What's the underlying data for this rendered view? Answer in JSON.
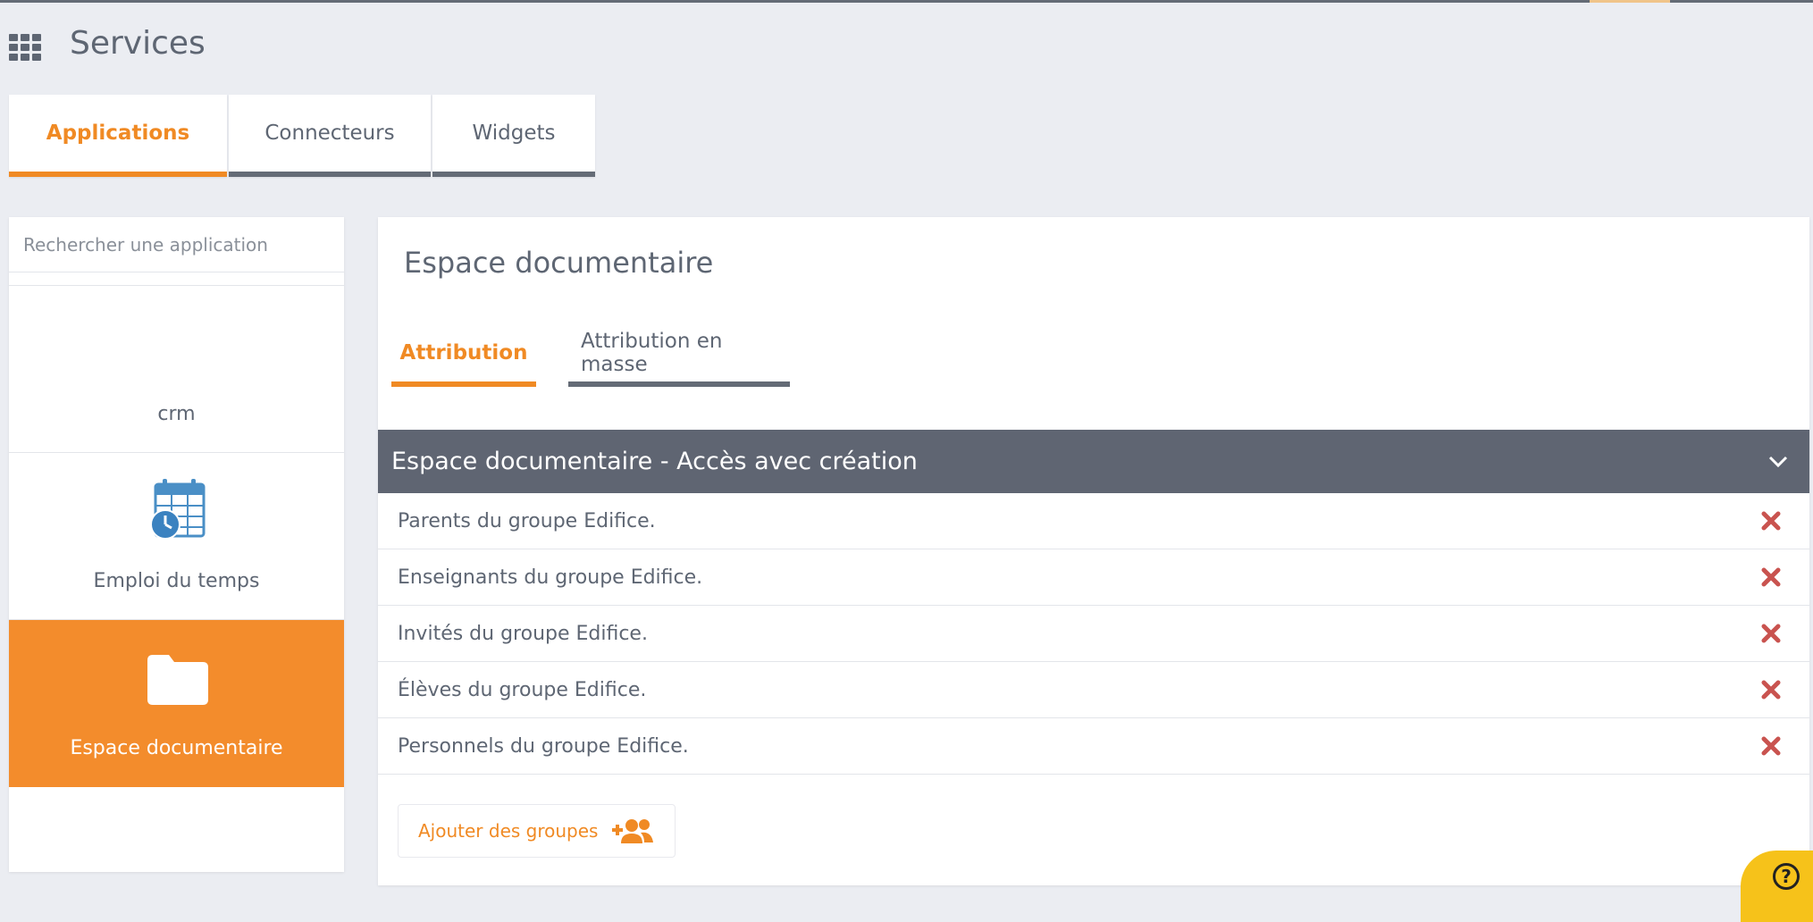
{
  "header": {
    "title": "Services",
    "apps_icon": "grid-icon"
  },
  "top_tabs": [
    {
      "label": "Applications",
      "active": true
    },
    {
      "label": "Connecteurs",
      "active": false
    },
    {
      "label": "Widgets",
      "active": false
    }
  ],
  "sidebar": {
    "search_placeholder": "Rechercher une application",
    "items": [
      {
        "label": "crm",
        "icon": "",
        "active": false
      },
      {
        "label": "Emploi du temps",
        "icon": "calendar-clock-icon",
        "active": false
      },
      {
        "label": "Espace documentaire",
        "icon": "folder-icon",
        "active": true
      }
    ]
  },
  "main": {
    "title": "Espace documentaire",
    "tabs": [
      {
        "label": "Attribution",
        "active": true
      },
      {
        "label": "Attribution en masse",
        "active": false
      }
    ],
    "accordion": {
      "title": "Espace documentaire - Accès avec création",
      "icon": "chevron-down-icon",
      "groups": [
        "Parents du groupe Edifice.",
        "Enseignants du groupe Edifice.",
        "Invités du groupe Edifice.",
        "Élèves du groupe Edifice.",
        "Personnels du groupe Edifice."
      ]
    },
    "add_button_label": "Ajouter des groupes"
  },
  "colors": {
    "accent": "#f08a24",
    "header_bar": "#5f6572",
    "remove": "#c9534f",
    "help": "#f6c21a"
  }
}
